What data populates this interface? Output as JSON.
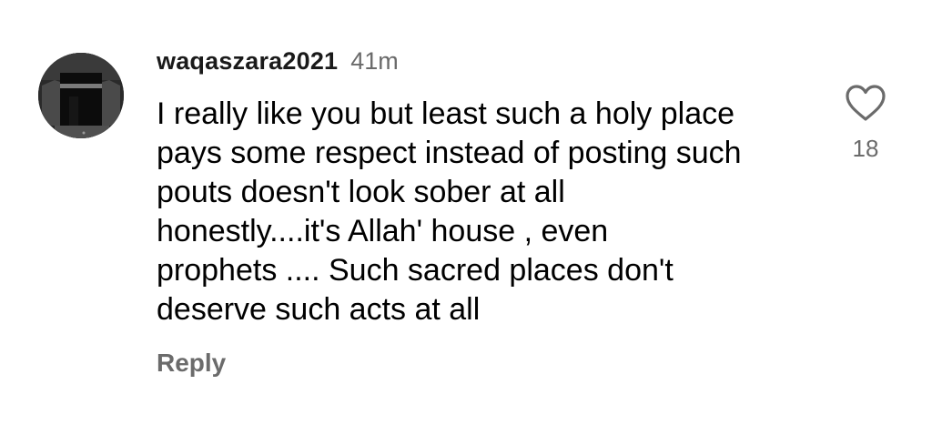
{
  "comment": {
    "username": "waqaszara2021",
    "time_ago": "41m",
    "avatar_icon": "kaaba-photo-avatar",
    "text_lines": [
      "I really like you but least such a holy place",
      "pays some respect instead of posting such",
      "pouts doesn't look sober at all",
      "honestly....it's Allah' house , even",
      "prophets .... Such sacred places don't",
      "deserve such acts at all"
    ],
    "reply_label": "Reply",
    "like_icon": "heart-outline-icon",
    "like_count": "18"
  },
  "colors": {
    "text": "#000000",
    "muted": "#6b6b6b",
    "background": "#ffffff"
  }
}
